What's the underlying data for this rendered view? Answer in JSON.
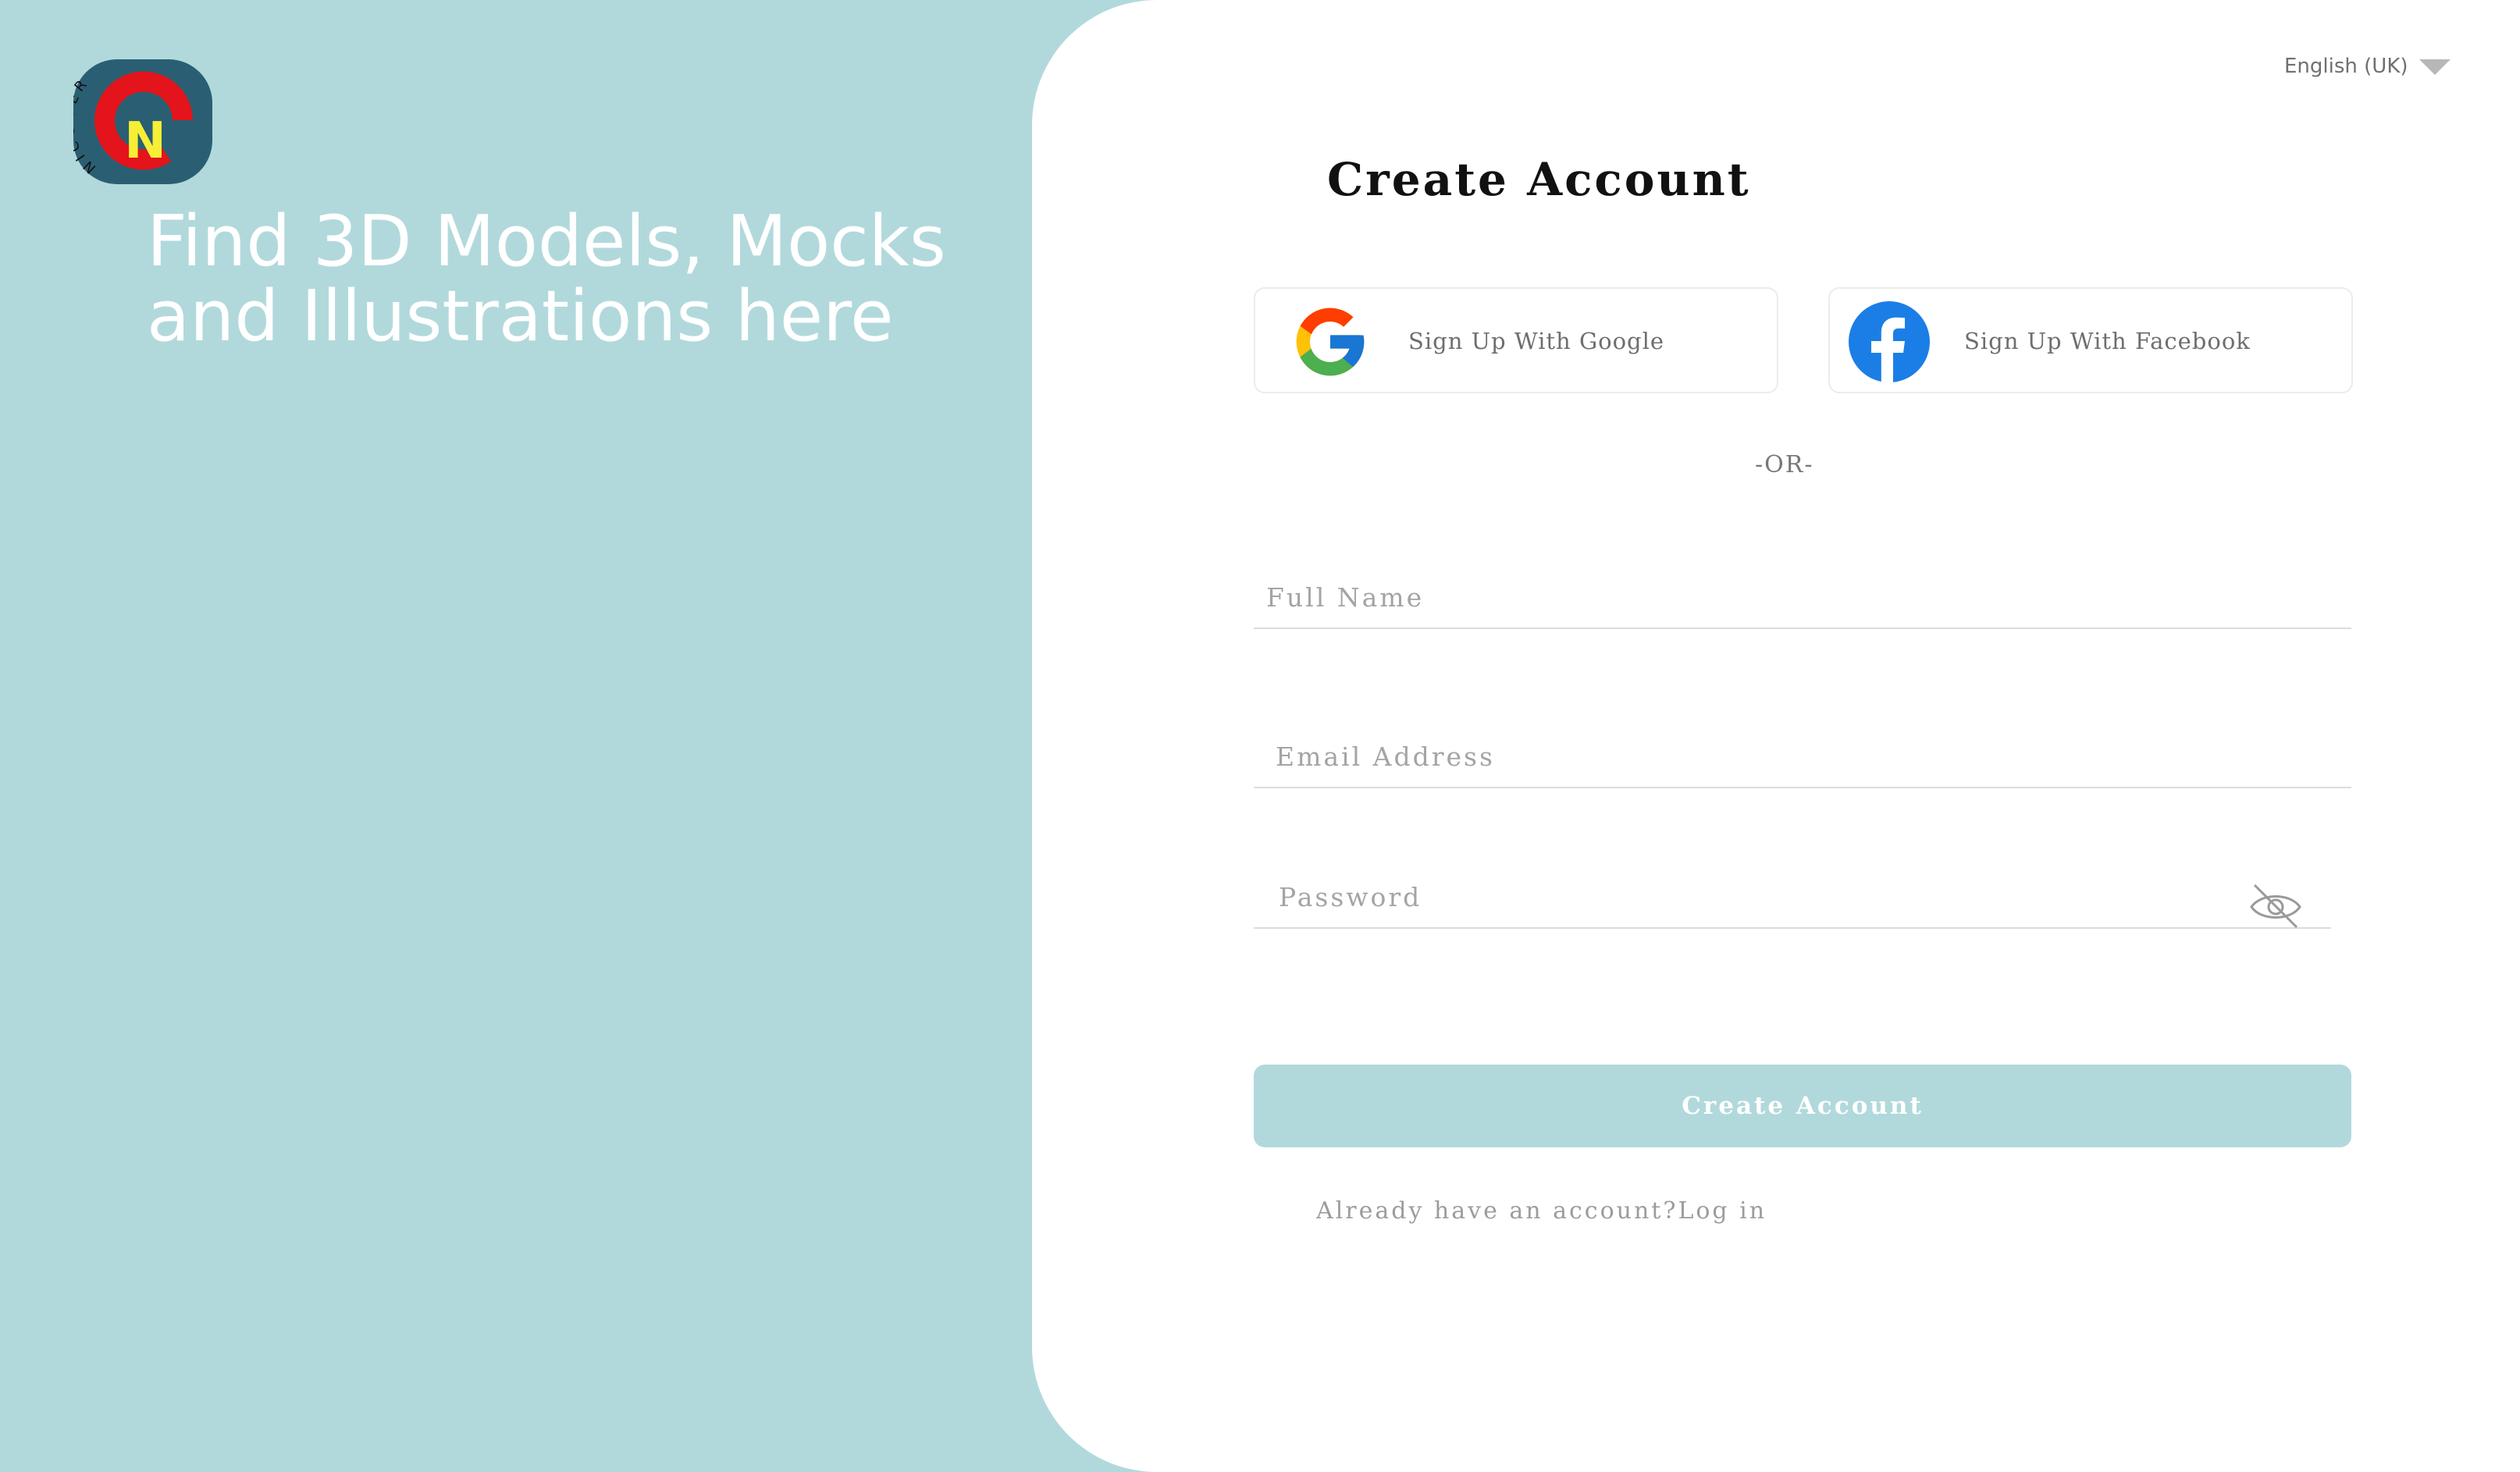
{
  "brand": {
    "logo_icon": "nicoder-logo-icon",
    "logo_letter": "N",
    "logo_arc_text": "NICODER",
    "tagline": "Find 3D Models, Mocks and Illustrations here"
  },
  "language": {
    "selected": "English (UK)",
    "icon": "chevron-down-icon"
  },
  "form": {
    "title": "Create Account",
    "google_label": "Sign Up With Google",
    "facebook_label": "Sign Up With Facebook",
    "or_text": "-OR-",
    "full_name_placeholder": "Full Name",
    "email_placeholder": "Email Address",
    "password_placeholder": "Password",
    "password_toggle_icon": "eye-off-icon",
    "submit_label": "Create Account",
    "login_prompt": "Already have an account?",
    "login_link": "Log in"
  },
  "colors": {
    "accent": "#b1d9dc",
    "logo_bg": "#2a5f73",
    "logo_ring": "#e3141b",
    "logo_letter": "#f7ef35",
    "facebook_blue": "#1b7ee6"
  }
}
